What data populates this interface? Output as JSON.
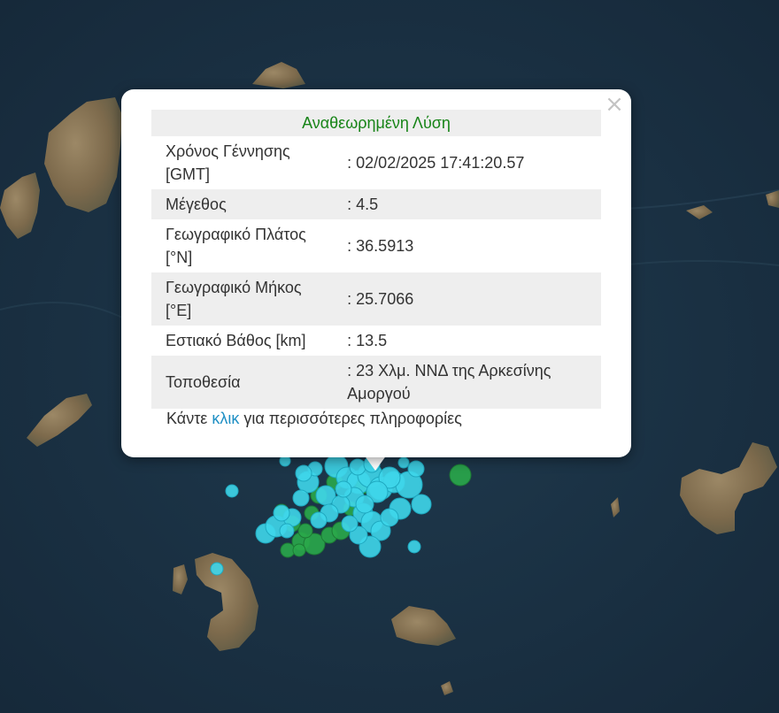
{
  "popup": {
    "header": "Αναθεωρημένη Λύση",
    "close_glyph": "×",
    "rows": [
      {
        "label": "Χρόνος Γέννησης [GMT]",
        "value": ": 02/02/2025 17:41:20.57"
      },
      {
        "label": "Μέγεθος",
        "value": ": 4.5"
      },
      {
        "label": "Γεωγραφικό Πλάτος [°N]",
        "value": ": 36.5913"
      },
      {
        "label": "Γεωγραφικό Μήκος [°E]",
        "value": ": 25.7066"
      },
      {
        "label": "Εστιακό Βάθος [km]",
        "value": ": 13.5"
      },
      {
        "label": "Τοποθεσία",
        "value": ": 23 Χλμ. ΝΝΔ της Αρκεσίνης Αμοργού"
      }
    ],
    "footer_prefix": "Κάντε ",
    "footer_link": "κλικ",
    "footer_suffix": " για περισσότερες πληροφορίες"
  },
  "map": {
    "sea_color": "#1b3447",
    "land_color": "#8a7656",
    "marker_colors": {
      "recent": "#3fd6ea",
      "older": "#2aa84a"
    }
  }
}
